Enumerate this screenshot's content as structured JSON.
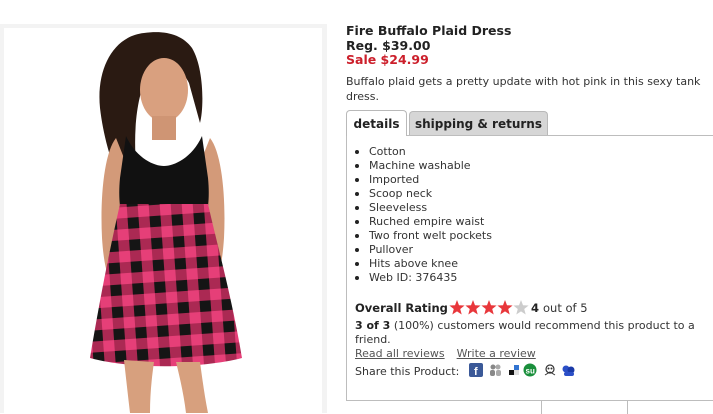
{
  "product": {
    "title": "Fire Buffalo Plaid Dress",
    "regular_price": "Reg. $39.00",
    "sale_price": "Sale $24.99",
    "description": "Buffalo plaid gets a pretty update with hot pink in this sexy tank dress."
  },
  "tabs": [
    {
      "label": "details",
      "active": true
    },
    {
      "label": "shipping & returns",
      "active": false
    }
  ],
  "details": {
    "features": [
      "Cotton",
      "Machine washable",
      "Imported",
      "Scoop neck",
      "Sleeveless",
      "Ruched empire waist",
      "Two front welt pockets",
      "Pullover",
      "Hits above knee",
      "Web ID: 376435"
    ]
  },
  "rating": {
    "label": "Overall Rating",
    "value": 4,
    "max": 5,
    "value_text": "4",
    "out_of_text": "out of 5",
    "star_color": "#e8373b",
    "empty_star_color": "#cccccc"
  },
  "recommend": {
    "count": "3 of 3",
    "percent": "(100%)",
    "text": "customers would recommend this product to a friend."
  },
  "review_links": {
    "read_all": "Read all reviews",
    "write": "Write a review"
  },
  "share": {
    "label": "Share this Product:",
    "icons": [
      "facebook-icon",
      "myspace-icon",
      "delicious-icon",
      "stumbleupon-icon",
      "digg-icon",
      "windows-live-icon"
    ]
  },
  "colors": {
    "sale_red": "#cc1f2b",
    "plaid_pink": "#e63f78",
    "plaid_dark": "#1a1a1a",
    "tab_inactive_bg": "#d6d6d6"
  }
}
